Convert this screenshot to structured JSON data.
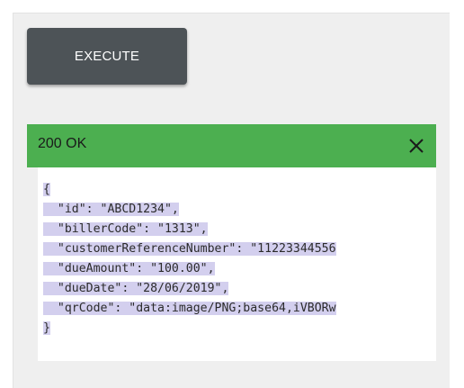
{
  "execute_label": "EXECUTE",
  "response": {
    "status": "200 OK",
    "lines": [
      "{",
      "  \"id\": \"ABCD1234\",",
      "  \"billerCode\": \"1313\",",
      "  \"customerReferenceNumber\": \"11223344556",
      "  \"dueAmount\": \"100.00\",",
      "  \"dueDate\": \"28/06/2019\",",
      "  \"qrCode\": \"data:image/PNG;base64,iVBORw",
      "}"
    ]
  },
  "icons": {
    "close": "close-icon"
  },
  "colors": {
    "status_success": "#4caf50",
    "execute_button": "#4d5357",
    "selection": "#d3cfee"
  }
}
